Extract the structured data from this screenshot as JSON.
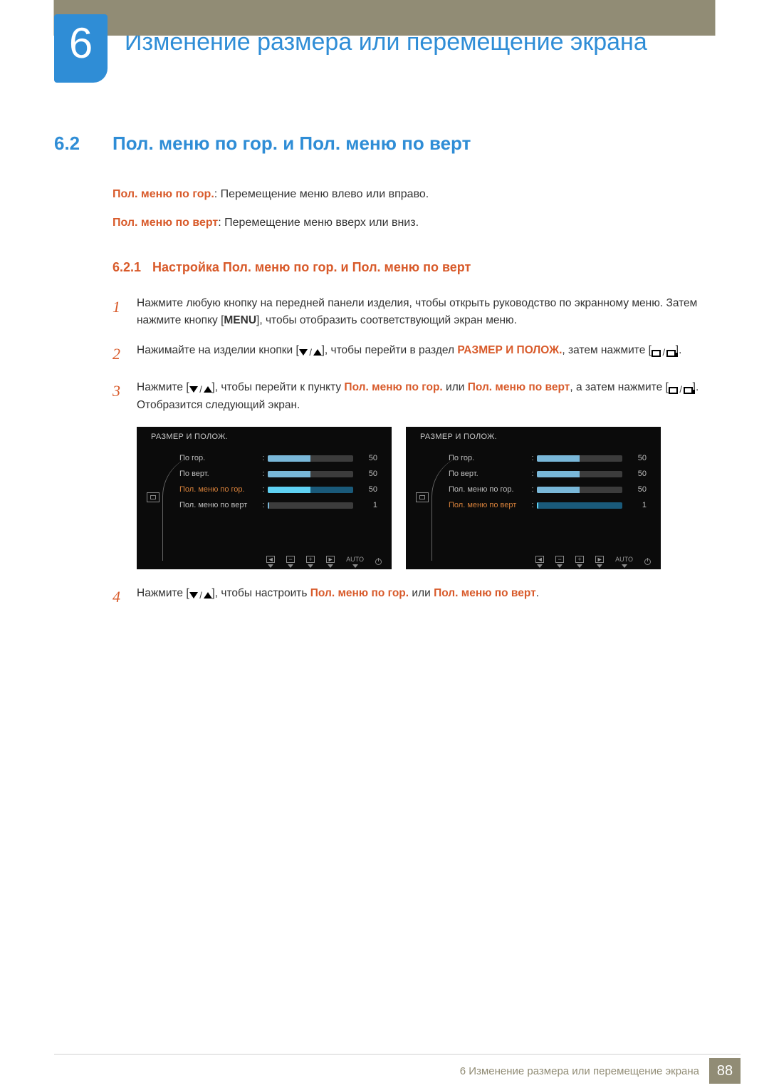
{
  "chapter": {
    "number": "6",
    "title": "Изменение размера или перемещение экрана"
  },
  "section": {
    "number": "6.2",
    "title": "Пол. меню по гор. и Пол. меню по верт"
  },
  "desc1": {
    "bold": "Пол. меню по гор.",
    "rest": ": Перемещение меню влево или вправо."
  },
  "desc2": {
    "bold": "Пол. меню по верт",
    "rest": ": Перемещение меню вверх или вниз."
  },
  "subsection": {
    "number": "6.2.1",
    "title": "Настройка Пол. меню по гор. и Пол. меню по верт"
  },
  "steps": {
    "1": {
      "n": "1",
      "a": "Нажмите любую кнопку на передней панели изделия, чтобы открыть руководство по экранному меню. Затем нажмите кнопку [",
      "menu": "MENU",
      "b": "], чтобы отобразить соответствующий экран меню."
    },
    "2": {
      "n": "2",
      "a": "Нажимайте на изделии кнопки [",
      "b": "], чтобы перейти в раздел ",
      "sect": "РАЗМЕР И ПОЛОЖ.",
      "c": ", затем нажмите [",
      "d": "]."
    },
    "3": {
      "n": "3",
      "a": "Нажмите [",
      "b": "], чтобы перейти к пункту ",
      "p1": "Пол. меню по гор.",
      "or1": " или ",
      "p2": "Пол. меню по верт",
      "c": ", а затем нажмите [",
      "d": "]. Отобразится следующий экран."
    },
    "4": {
      "n": "4",
      "a": "Нажмите [",
      "b": "], чтобы настроить ",
      "p1": "Пол. меню по гор.",
      "or1": " или ",
      "p2": "Пол. меню по верт",
      "c": "."
    }
  },
  "osd": {
    "title": "РАЗМЕР И ПОЛОЖ.",
    "rows": [
      {
        "label": "По гор.",
        "value": "50",
        "fill": 50
      },
      {
        "label": "По верт.",
        "value": "50",
        "fill": 50
      },
      {
        "label": "Пол. меню по гор.",
        "value": "50",
        "fill": 50
      },
      {
        "label": "Пол. меню по верт",
        "value": "1",
        "fill": 2
      }
    ],
    "hl_left_index": 2,
    "hl_right_index": 3,
    "auto": "AUTO"
  },
  "footer": {
    "text": "6 Изменение размера или перемещение экрана",
    "page": "88"
  }
}
